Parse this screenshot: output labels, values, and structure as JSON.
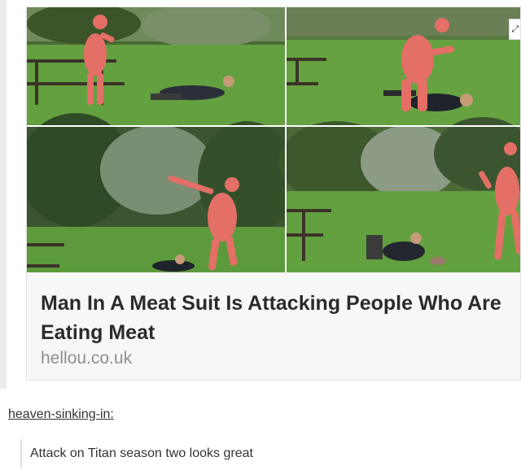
{
  "post": {
    "headline": "Man In A Meat Suit Is Attacking People Who Are Eating Meat",
    "source": "hellou.co.uk",
    "expand_glyph": "⤢",
    "photos": [
      {
        "scene": "meat suit figure standing by picnic table, man lying on grass"
      },
      {
        "scene": "meat suit figure grappling man on ground"
      },
      {
        "scene": "meat suit figure gesturing, man lying in grass"
      },
      {
        "scene": "meat suit figure running away, man sitting on grass"
      }
    ]
  },
  "reblog": {
    "username": "heaven-sinking-in",
    "username_suffix": ":",
    "comment": "Attack on Titan season two looks great"
  },
  "colors": {
    "grass": "#5f9b3e",
    "trees": "#3f5a2d",
    "suit": "#e36f66",
    "headline": "#2b2b2b",
    "source": "#8f8f8f"
  }
}
